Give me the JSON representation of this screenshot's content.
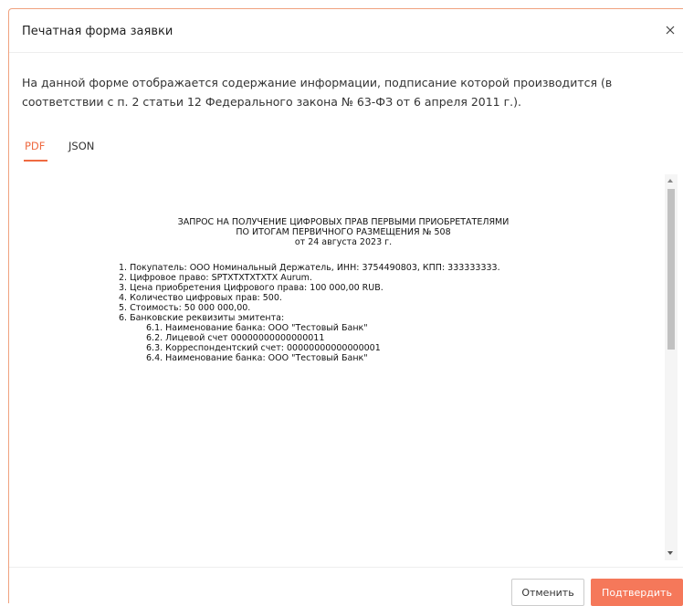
{
  "modal": {
    "title": "Печатная форма заявки",
    "description": "На данной форме отображается содержание информации, подписание которой производится (в соответствии с п. 2 статьи 12 Федерального закона № 63-ФЗ от 6 апреля 2011 г.).",
    "close_icon": "close-icon",
    "accent_color": "#ef6a41"
  },
  "tabs": [
    {
      "label": "PDF",
      "active": true
    },
    {
      "label": "JSON",
      "active": false
    }
  ],
  "document": {
    "title_line1": "ЗАПРОС НА ПОЛУЧЕНИЕ ЦИФРОВЫХ ПРАВ ПЕРВЫМИ ПРИОБРЕТАТЕЛЯМИ",
    "title_line2": "ПО ИТОГАМ ПЕРВИЧНОГО РАЗМЕЩЕНИЯ № 508",
    "title_line3": "от 24 августа 2023 г.",
    "items": [
      "1. Покупатель: ООО Номинальный Держатель, ИНН: 3754490803, КПП: 333333333.",
      "2. Цифровое право: SPTXTXTXTXTX Aurum.",
      "3. Цена приобретения Цифрового права: 100 000,00 RUB.",
      "4. Количество цифровых прав: 500.",
      "5. Стоимость: 50 000 000,00.",
      "6. Банковские реквизиты эмитента:"
    ],
    "subitems": [
      "6.1. Наименование банка: ООО \"Тестовый Банк\"",
      "6.2. Лицевой счет 00000000000000011",
      "6.3. Корреспондентский счет: 00000000000000001",
      "6.4. Наименование банка: ООО \"Тестовый Банк\""
    ]
  },
  "footer": {
    "cancel_label": "Отменить",
    "confirm_label": "Подтвердить",
    "confirm_color": "#f5785a"
  }
}
